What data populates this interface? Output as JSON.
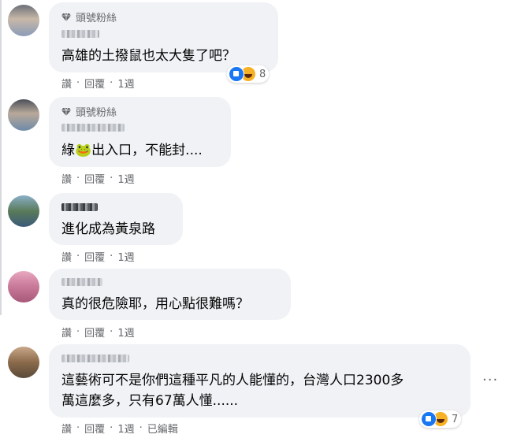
{
  "comments": [
    {
      "badge": "頭號粉絲",
      "text_lines": [
        "高雄的土撥鼠也太大隻了吧？"
      ],
      "actions": {
        "like": "讚",
        "reply": "回覆",
        "time": "1週"
      },
      "reactions": {
        "icons": [
          "like-icon",
          "haha-icon"
        ],
        "count": "8"
      }
    },
    {
      "badge": "頭號粉絲",
      "text_lines": [
        "綠🐸出入口，不能封...."
      ],
      "actions": {
        "like": "讚",
        "reply": "回覆",
        "time": "1週"
      }
    },
    {
      "text_lines": [
        "進化成為黃泉路"
      ],
      "actions": {
        "like": "讚",
        "reply": "回覆",
        "time": "1週"
      }
    },
    {
      "text_lines": [
        "真的很危險耶，用心點很難嗎？"
      ],
      "actions": {
        "like": "讚",
        "reply": "回覆",
        "time": "1週"
      }
    },
    {
      "text_lines": [
        "這藝術可不是你們這種平凡的人能懂的，台灣人口2300多",
        "萬這麼多，只有67萬人懂......"
      ],
      "actions": {
        "like": "讚",
        "reply": "回覆",
        "time": "1週",
        "edited": "已編輯"
      },
      "reactions": {
        "icons": [
          "like-icon",
          "haha-icon"
        ],
        "count": "7"
      },
      "more_label": "···"
    }
  ],
  "colors": {
    "bubble": "#f0f2f5",
    "meta": "#65676b",
    "like": "#1877f2",
    "haha": "#f7b125"
  }
}
